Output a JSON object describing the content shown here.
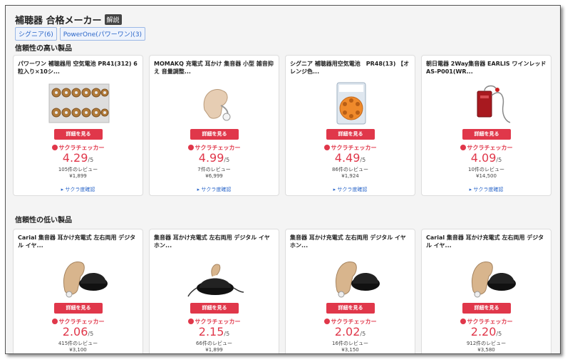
{
  "header": {
    "title": "補聴器 合格メーカー",
    "badge": "解説"
  },
  "makers": [
    {
      "label": "シグニア(6)"
    },
    {
      "label": "PowerOne(パワーワン)(3)"
    }
  ],
  "sections": [
    {
      "title": "信頼性の高い製品",
      "products": [
        {
          "title": "パワーワン 補聴器用 空気電池 PR41(312) 6粒入り×10シ...",
          "image": "battery-sheet",
          "button": "詳細を見る",
          "brand": "サクラチェッカー",
          "score": "4.29",
          "denom": "/5",
          "reviews": "105件のレビュー",
          "price": "¥1,899",
          "check": "サクラ度確認"
        },
        {
          "title": "MOMAKQ 充電式 耳かけ 集音器 小型 雑音抑え 音量調整...",
          "image": "hearing-aid-behind-ear",
          "button": "詳細を見る",
          "brand": "サクラチェッカー",
          "score": "4.99",
          "denom": "/5",
          "reviews": "7件のレビュー",
          "price": "¥6,999",
          "check": "サクラ度確認"
        },
        {
          "title": "シグニア 補聴器用空気電池　PR48(13) 【オレンジ色...",
          "image": "battery-pack",
          "button": "詳細を見る",
          "brand": "サクラチェッカー",
          "score": "4.49",
          "denom": "/5",
          "reviews": "86件のレビュー",
          "price": "¥1,924",
          "check": "サクラ度確認"
        },
        {
          "title": "朝日電器 2Way集音器 EARLIS ワインレッド AS-P001(WR...",
          "image": "sound-amplifier-red",
          "button": "詳細を見る",
          "brand": "サクラチェッカー",
          "score": "4.09",
          "denom": "/5",
          "reviews": "10件のレビュー",
          "price": "¥14,500",
          "check": "サクラ度確認"
        }
      ]
    },
    {
      "title": "信頼性の低い製品",
      "products": [
        {
          "title": "Carial 集音器 耳かけ充電式 左右両用 デジタル イヤ...",
          "image": "hearing-aid-dock",
          "button": "詳細を見る",
          "brand": "サクラチェッカー",
          "score": "2.06",
          "denom": "/5",
          "reviews": "415件のレビュー",
          "price": "¥3,100"
        },
        {
          "title": "集音器 耳かけ充電式 左右両用 デジタル イヤホン...",
          "image": "hearing-aid-dock-small",
          "button": "詳細を見る",
          "brand": "サクラチェッカー",
          "score": "2.15",
          "denom": "/5",
          "reviews": "66件のレビュー",
          "price": "¥1,899"
        },
        {
          "title": "集音器 耳かけ充電式 左右両用 デジタル イヤホン...",
          "image": "hearing-aid-dock",
          "button": "詳細を見る",
          "brand": "サクラチェッカー",
          "score": "2.02",
          "denom": "/5",
          "reviews": "16件のレビュー",
          "price": "¥3,150"
        },
        {
          "title": "Carial 集音器 耳かけ充電式 左右両用 デジタル イヤ...",
          "image": "hearing-aid-dock",
          "button": "詳細を見る",
          "brand": "サクラチェッカー",
          "score": "2.20",
          "denom": "/5",
          "reviews": "912件のレビュー",
          "price": "¥3,580"
        }
      ]
    }
  ]
}
